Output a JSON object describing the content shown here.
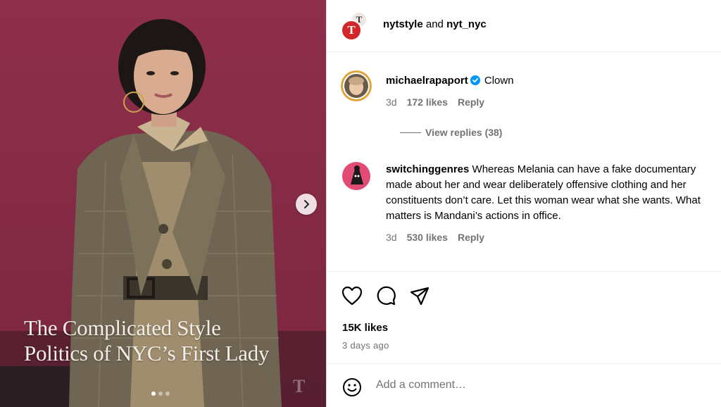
{
  "post": {
    "media_caption_line1": "The Complicated Style",
    "media_caption_line2": "Politics of NYC’s First Lady",
    "watermark": "T",
    "carousel_count": 3,
    "carousel_index": 1
  },
  "header": {
    "account1": "nytstyle",
    "joiner": "and",
    "account2": "nyt_nyc",
    "avatar_back_glyph": "T",
    "avatar_front_glyph": "T"
  },
  "comments": [
    {
      "username": "michaelrapaport",
      "verified": true,
      "text": "Clown",
      "age": "3d",
      "likes": "172 likes",
      "reply_label": "Reply",
      "view_replies": "View replies (38)"
    },
    {
      "username": "switchinggenres",
      "verified": false,
      "text": "Whereas Melania can have a fake documentary made about her and wear deliberately offensive clothing and her constituents don’t care. Let this woman wear what she wants. What matters is Mandani’s actions in office.",
      "age": "3d",
      "likes": "530 likes",
      "reply_label": "Reply"
    }
  ],
  "actions": {
    "icons": [
      "heart-icon",
      "comment-icon",
      "share-icon"
    ],
    "likes_count": "15K likes",
    "posted_date": "3 days ago"
  },
  "composer": {
    "placeholder": "Add a comment…",
    "emoji_icon": "emoji-icon"
  },
  "colors": {
    "media_background": "#8e2f4c",
    "nyt_red": "#d3262b",
    "verified_blue": "#0095f6",
    "secondary_text": "#737373"
  }
}
